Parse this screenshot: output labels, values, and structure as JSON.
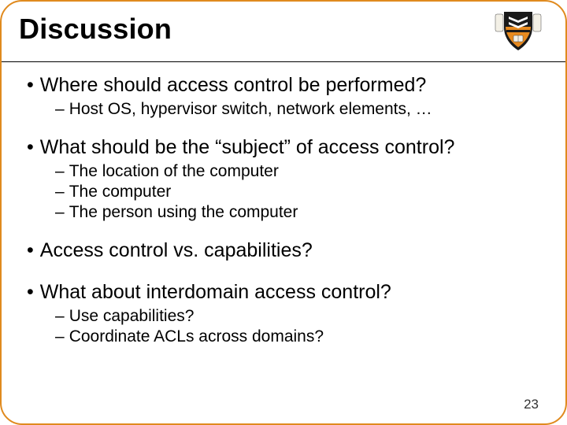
{
  "title": "Discussion",
  "bullets": {
    "q1": "Where should access control be performed?",
    "q1_s1": "Host OS, hypervisor switch, network elements, …",
    "q2": "What should be the “subject” of access control?",
    "q2_s1": "The location of the computer",
    "q2_s2": "The computer",
    "q2_s3": "The person using the computer",
    "q3": "Access control vs. capabilities?",
    "q4": "What about interdomain access control?",
    "q4_s1": "Use capabilities?",
    "q4_s2": "Coordinate ACLs across domains?"
  },
  "page_number": "23",
  "icon": "princeton-shield",
  "colors": {
    "border": "#e08a1e",
    "shield_orange": "#e78a1f"
  }
}
